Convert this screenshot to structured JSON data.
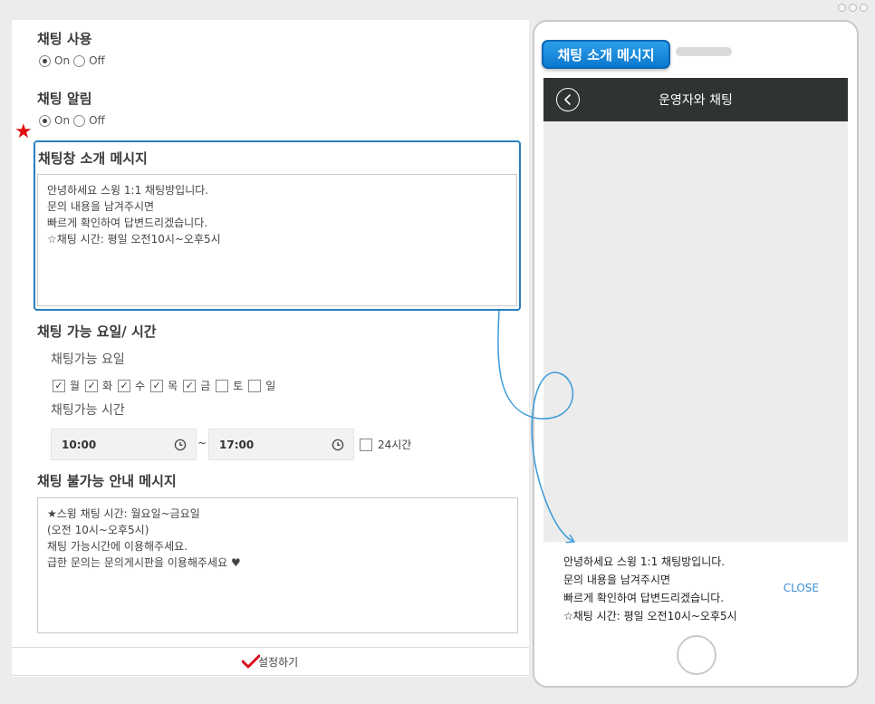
{
  "settings": {
    "chat_use": {
      "title": "채팅 사용",
      "on": "On",
      "off": "Off",
      "selected": "On"
    },
    "chat_alert": {
      "title": "채팅 알림",
      "on": "On",
      "off": "Off",
      "selected": "On"
    },
    "intro_message": {
      "title": "채팅창 소개 메시지",
      "text": "안녕하세요 스윙 1:1 채팅방입니다.\n문의 내용을 남겨주시면\n빠르게 확인하여 답변드리겠습니다.\n☆채팅 시간: 평일 오전10시~오후5시"
    },
    "available": {
      "title": "채팅 가능 요일/ 시간",
      "days_label": "채팅가능 요일",
      "days": [
        {
          "label": "월",
          "checked": true
        },
        {
          "label": "화",
          "checked": true
        },
        {
          "label": "수",
          "checked": true
        },
        {
          "label": "목",
          "checked": true
        },
        {
          "label": "금",
          "checked": true
        },
        {
          "label": "토",
          "checked": false
        },
        {
          "label": "일",
          "checked": false
        }
      ],
      "time_label": "채팅가능 시간",
      "start": "10:00",
      "separator": "~",
      "end": "17:00",
      "all_day_label": "24시간",
      "all_day_checked": false
    },
    "unavailable": {
      "title": "채팅 불가능 안내 메시지",
      "text": "★스윙 채팅 시간: 월요일~금요일\n(오전 10시~오후5시)\n채팅 가능시간에 이용해주세요.\n급한 문의는 문의게시판을 이용해주세요 ♥"
    },
    "save_label": "설정하기"
  },
  "phone": {
    "badge": "채팅 소개 메시지",
    "header_title": "운영자와 채팅",
    "popup_text": "안녕하세요 스윙 1:1 채팅방입니다.\n문의 내용을 남겨주시면\n빠르게 확인하여 답변드리겠습니다.\n☆채팅 시간: 평일 오전10시~오후5시",
    "close_label": "CLOSE"
  },
  "colors": {
    "accent_blue": "#2a7fbf",
    "header_dark": "#2f3430",
    "star_red": "#e01010",
    "check_red": "#d8101e"
  }
}
